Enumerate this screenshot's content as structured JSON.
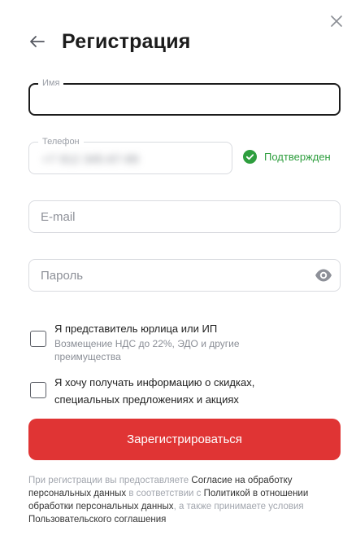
{
  "header": {
    "title": "Регистрация"
  },
  "form": {
    "name": {
      "label": "Имя",
      "value": ""
    },
    "phone": {
      "label": "Телефон",
      "value": "+7 912 345-67-89",
      "status": "Подтвержден"
    },
    "email": {
      "placeholder": "E-mail"
    },
    "password": {
      "placeholder": "Пароль"
    }
  },
  "checkboxes": [
    {
      "label": "Я представитель юрлица или ИП",
      "sublabel": "Возмещение НДС до 22%, ЭДО и другие преимущества",
      "checked": false
    },
    {
      "label": "Я хочу получать информацию о скидках, специальных предложениях и акциях",
      "checked": false
    }
  ],
  "submit": {
    "label": "Зарегистрироваться"
  },
  "legal": {
    "t1": "При регистрации вы предоставляете ",
    "link1": "Согласие на обработку персональных данных",
    "t2": " в соответствии с ",
    "link2": "Политикой в отношении обработки персональных данных",
    "t3": ", а также принимаете условия ",
    "link3": "Пользовательского соглашения"
  },
  "icons": [
    "close-icon",
    "arrow-left-icon",
    "check-circle-icon",
    "eye-icon"
  ],
  "colors": {
    "accent": "#e03434",
    "success": "#2e9e3e",
    "text": "#222222",
    "muted": "#9a9ea6",
    "border": "#d9dbe0"
  }
}
